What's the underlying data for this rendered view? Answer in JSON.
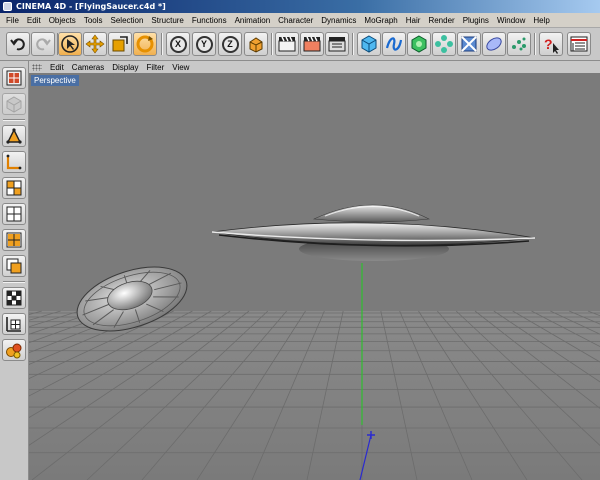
{
  "window": {
    "title": "CINEMA 4D - [FlyingSaucer.c4d *]"
  },
  "menubar": {
    "items": [
      "File",
      "Edit",
      "Objects",
      "Tools",
      "Selection",
      "Structure",
      "Functions",
      "Animation",
      "Character",
      "Dynamics",
      "MoGraph",
      "Hair",
      "Render",
      "Plugins",
      "Window",
      "Help"
    ]
  },
  "toolbar": {
    "x_axis": "X",
    "y_axis": "Y",
    "z_axis": "Z",
    "help": "?"
  },
  "viewport": {
    "menu": [
      "Edit",
      "Cameras",
      "Display",
      "Filter",
      "View"
    ],
    "view_name": "Perspective"
  },
  "colors": {
    "accent": "#4a6fa4",
    "viewport_bg": "#7b7b7b",
    "y_axis": "#2fbf2f",
    "z_axis": "#2a2ad0"
  }
}
